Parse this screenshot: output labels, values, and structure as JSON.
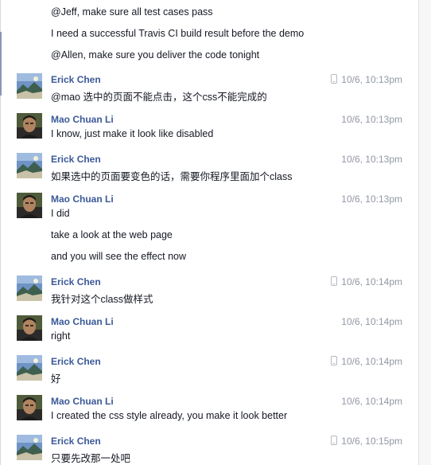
{
  "orphan_messages": [
    "@Jeff, make sure all test cases pass",
    "I need a successful Travis CI build result before the demo",
    "@Allen, make sure you deliver the code tonight"
  ],
  "groups": [
    {
      "sender": "Erick Chen",
      "avatar": "landscape-avatar",
      "time": "10/6, 10:13pm",
      "mobile": true,
      "messages": [
        "@mao 选中的页面不能点击，这个css不能完成的"
      ]
    },
    {
      "sender": "Mao Chuan Li",
      "avatar": "person-avatar",
      "time": "10/6, 10:13pm",
      "mobile": false,
      "messages": [
        "I know, just make it look like disabled"
      ]
    },
    {
      "sender": "Erick Chen",
      "avatar": "landscape-avatar",
      "time": "10/6, 10:13pm",
      "mobile": false,
      "messages": [
        "如果选中的页面要变色的话，需要你程序里面加个class"
      ]
    },
    {
      "sender": "Mao Chuan Li",
      "avatar": "person-avatar",
      "time": "10/6, 10:13pm",
      "mobile": false,
      "messages": [
        "I did",
        "take a look at the web page",
        "and you will see the effect now"
      ]
    },
    {
      "sender": "Erick Chen",
      "avatar": "landscape-avatar",
      "time": "10/6, 10:14pm",
      "mobile": true,
      "messages": [
        "我针对这个class做样式"
      ]
    },
    {
      "sender": "Mao Chuan Li",
      "avatar": "person-avatar",
      "time": "10/6, 10:14pm",
      "mobile": false,
      "messages": [
        "right"
      ]
    },
    {
      "sender": "Erick Chen",
      "avatar": "landscape-avatar",
      "time": "10/6, 10:14pm",
      "mobile": true,
      "messages": [
        "好"
      ]
    },
    {
      "sender": "Mao Chuan Li",
      "avatar": "person-avatar",
      "time": "10/6, 10:14pm",
      "mobile": false,
      "messages": [
        "I created the css style already, you make it look better"
      ]
    },
    {
      "sender": "Erick Chen",
      "avatar": "landscape-avatar",
      "time": "10/6, 10:15pm",
      "mobile": true,
      "messages": [
        "只要先改那一处吧"
      ]
    }
  ],
  "colors": {
    "sender_name": "#3b5998",
    "timestamp": "#9197a3",
    "message_text": "#141823"
  }
}
